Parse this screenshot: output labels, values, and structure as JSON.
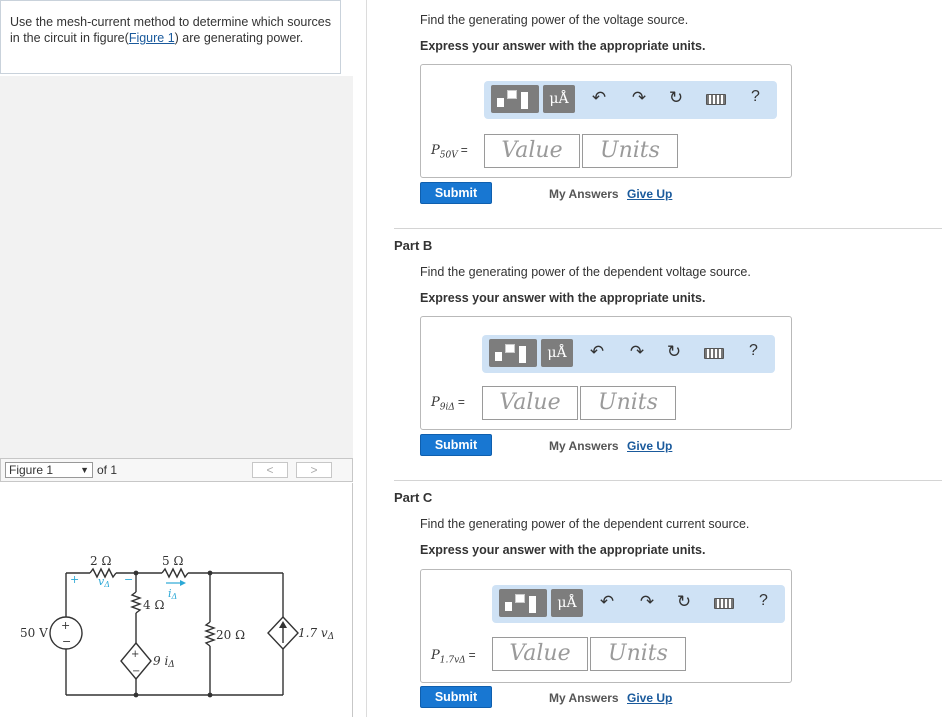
{
  "left": {
    "problem_text": "Use the mesh-current method to determine which sources in the circuit in figure(",
    "figure_link": "Figure 1",
    "problem_text_end": ") are generating power.",
    "figure_select": "Figure 1",
    "figure_of": "of 1",
    "prev": "<",
    "next": ">"
  },
  "circuit": {
    "r1": "2 Ω",
    "r2": "5 Ω",
    "r3": "4 Ω",
    "r4": "20 Ω",
    "vsrc": "50 V",
    "vdelta": "v",
    "vdelta_sub": "Δ",
    "idelta": "i",
    "idelta_sub": "Δ",
    "dep_v": "9 i",
    "dep_v_sub": "Δ",
    "dep_i": "1.7 v",
    "dep_i_sub": "Δ",
    "plus": "+",
    "minus": "−"
  },
  "parts": [
    {
      "title": "",
      "question": "Find the generating power of the voltage source.",
      "units_hint": "Express your answer with the appropriate units.",
      "label_main": "P",
      "label_sub": "50V",
      "equals": "=",
      "value_placeholder": "Value",
      "units_placeholder": "Units",
      "submit": "Submit",
      "my_answers": "My Answers",
      "give_up": "Give Up"
    },
    {
      "title": "Part B",
      "question": "Find the generating power of the dependent voltage source.",
      "units_hint": "Express your answer with the appropriate units.",
      "label_main": "P",
      "label_sub": "9iΔ",
      "equals": "=",
      "value_placeholder": "Value",
      "units_placeholder": "Units",
      "submit": "Submit",
      "my_answers": "My Answers",
      "give_up": "Give Up"
    },
    {
      "title": "Part C",
      "question": "Find the generating power of the dependent current source.",
      "units_hint": "Express your answer with the appropriate units.",
      "label_main": "P",
      "label_sub": "1.7vΔ",
      "equals": "=",
      "value_placeholder": "Value",
      "units_placeholder": "Units",
      "submit": "Submit",
      "my_answers": "My Answers",
      "give_up": "Give Up"
    }
  ],
  "toolbar": {
    "mu": "μÅ",
    "undo": "↶",
    "redo": "↷",
    "reset": "↻",
    "help": "?"
  }
}
